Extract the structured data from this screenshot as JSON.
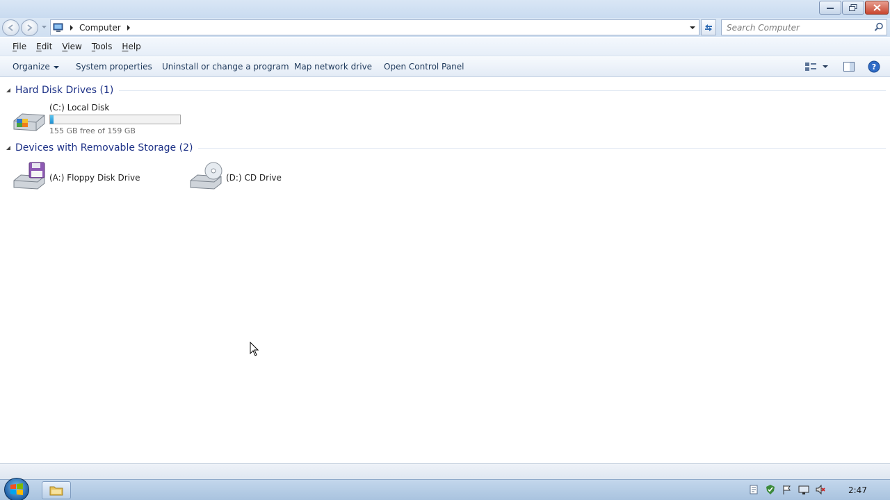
{
  "window": {
    "controls": {
      "minimize": "minimize-icon",
      "maximize": "restore-icon",
      "close": "close-icon"
    }
  },
  "address": {
    "breadcrumb": [
      "Computer"
    ],
    "search_placeholder": "Search Computer"
  },
  "menu": [
    {
      "key": "F",
      "rest": "ile"
    },
    {
      "key": "E",
      "rest": "dit"
    },
    {
      "key": "V",
      "rest": "iew"
    },
    {
      "key": "T",
      "rest": "ools"
    },
    {
      "key": "H",
      "rest": "elp"
    }
  ],
  "commands": {
    "organize": "Organize",
    "system_properties": "System properties",
    "uninstall": "Uninstall or change a program",
    "map_drive": "Map network drive",
    "control_panel": "Open Control Panel"
  },
  "groups": {
    "hard_disks": {
      "title": "Hard Disk Drives (1)",
      "drives": [
        {
          "name": "(C:) Local Disk",
          "free_text": "155 GB free of 159 GB",
          "used_fraction": 0.025
        }
      ]
    },
    "removable": {
      "title": "Devices with Removable Storage (2)",
      "drives": [
        {
          "name": "(A:) Floppy Disk Drive"
        },
        {
          "name": "(D:) CD Drive"
        }
      ]
    }
  },
  "taskbar": {
    "clock": "2:47"
  },
  "colors": {
    "group_title": "#1e3287",
    "command_text": "#1e395b",
    "capacity_fill": "#1d8fd2"
  }
}
